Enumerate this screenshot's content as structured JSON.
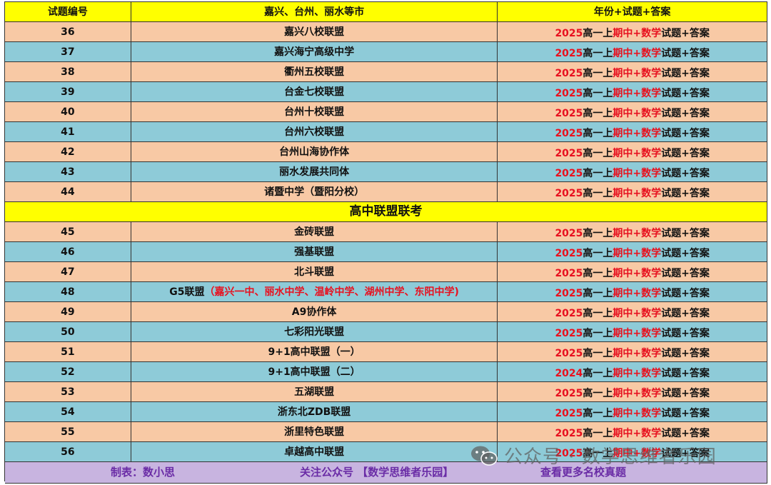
{
  "header": {
    "col1": "试题编号",
    "col2": "嘉兴、台州、丽水等市",
    "col3": "年份+试题+答案"
  },
  "colors": {
    "header_yellow": "#ffff00",
    "row_peach": "#f8c9a5",
    "row_blue": "#8ecbd8",
    "accent_red": "#e8101e",
    "footer_purple": "#c8b4e0",
    "footer_text": "#6a2ca6"
  },
  "answer_parts": {
    "grade": "高一上",
    "term": "期中",
    "plus": "+",
    "subject": "数学",
    "rest": "试题+答案"
  },
  "group1": [
    {
      "num": "36",
      "name": "嘉兴八校联盟",
      "year": "2025"
    },
    {
      "num": "37",
      "name": "嘉兴海宁高级中学",
      "year": "2025"
    },
    {
      "num": "38",
      "name": "衢州五校联盟",
      "year": "2025"
    },
    {
      "num": "39",
      "name": "台金七校联盟",
      "year": "2025"
    },
    {
      "num": "40",
      "name": "台州十校联盟",
      "year": "2025"
    },
    {
      "num": "41",
      "name": "台州六校联盟",
      "year": "2025"
    },
    {
      "num": "42",
      "name": "台州山海协作体",
      "year": "2025"
    },
    {
      "num": "43",
      "name": "丽水发展共同体",
      "year": "2025"
    },
    {
      "num": "44",
      "name": "诸暨中学（暨阳分校）",
      "year": "2025"
    }
  ],
  "section_title": "高中联盟联考",
  "group2": [
    {
      "num": "45",
      "name": "金砖联盟",
      "note": "",
      "year": "2025"
    },
    {
      "num": "46",
      "name": "强基联盟",
      "note": "",
      "year": "2025"
    },
    {
      "num": "47",
      "name": "北斗联盟",
      "note": "",
      "year": "2025"
    },
    {
      "num": "48",
      "name": "G5联盟",
      "note": "（嘉兴一中、丽水中学、温岭中学、湖州中学、东阳中学)",
      "year": "2025"
    },
    {
      "num": "49",
      "name": "A9协作体",
      "note": "",
      "year": "2025"
    },
    {
      "num": "50",
      "name": "七彩阳光联盟",
      "note": "",
      "year": "2025"
    },
    {
      "num": "51",
      "name": "9+1高中联盟（一）",
      "note": "",
      "year": "2025"
    },
    {
      "num": "52",
      "name": "9+1高中联盟（二）",
      "note": "",
      "year": "2024"
    },
    {
      "num": "53",
      "name": "五湖联盟",
      "note": "",
      "year": "2025"
    },
    {
      "num": "54",
      "name": "浙东北ZDB联盟",
      "note": "",
      "year": "2025"
    },
    {
      "num": "55",
      "name": "浙里特色联盟",
      "note": "",
      "year": "2025"
    },
    {
      "num": "56",
      "name": "卓越高中联盟",
      "note": "",
      "year": "2025"
    }
  ],
  "footer": {
    "maker": "制表：数小思",
    "follow": "关注公众号 【数学思维者乐园】",
    "more": "查看更多名校真题"
  },
  "watermark": {
    "icon": "wechat-icon",
    "text": "公众号 · 数学思维者乐园"
  }
}
